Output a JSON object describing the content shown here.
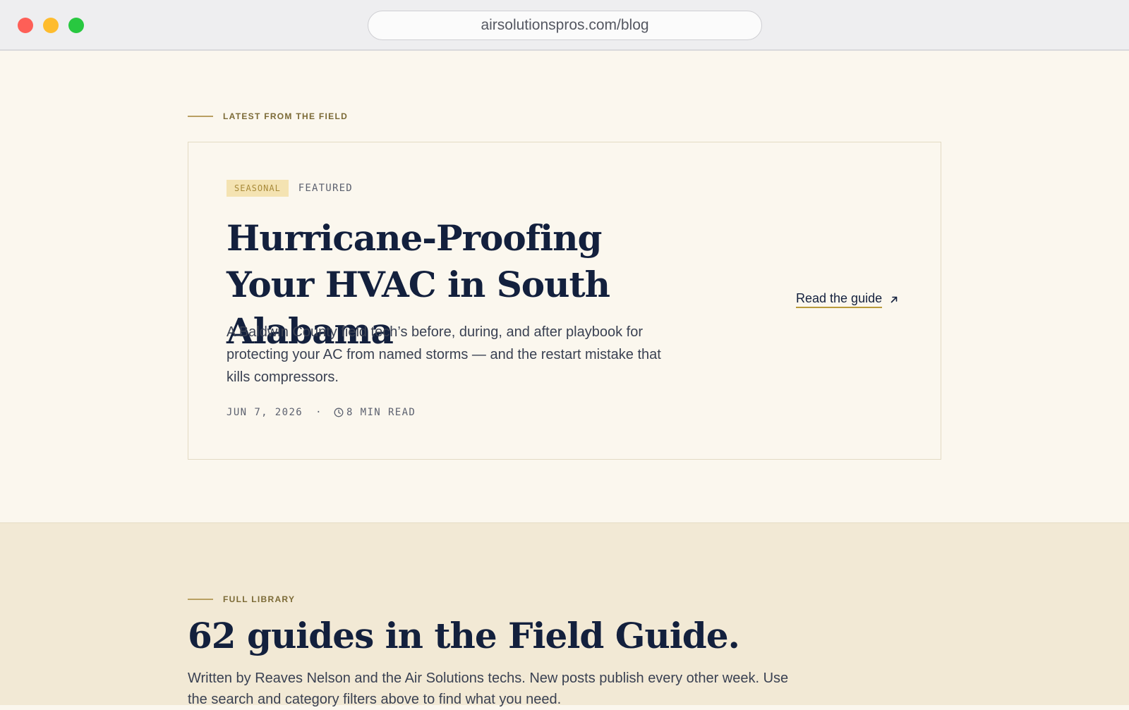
{
  "browser": {
    "url": "airsolutionspros.com/blog"
  },
  "featured": {
    "eyebrow": "LATEST FROM THE FIELD",
    "card": {
      "tag": "SEASONAL",
      "badge": "FEATURED",
      "title": "Hurricane-Proofing Your HVAC in South Alabama",
      "description": "A Baldwin County field tech’s before, during, and after playbook for protecting your AC from named storms — and the restart mistake that kills compressors.",
      "date": "JUN 7, 2026",
      "separator": "·",
      "read_time": "8 MIN READ",
      "cta": "Read the guide",
      "icons": {
        "clock": "clock-icon",
        "arrow": "arrow-up-right-icon"
      }
    }
  },
  "library": {
    "eyebrow": "FULL LIBRARY",
    "title": "62 guides in the Field Guide.",
    "description": "Written by Reaves Nelson and the Air Solutions techs. New posts publish every other week. Use the search and category filters above to find what you need."
  },
  "colors": {
    "page_bg": "#fbf7ee",
    "library_bg": "#f2e9d5",
    "heading": "#13203d",
    "accent_gold": "#b99a3a",
    "tag_bg": "#f4e3b2"
  }
}
